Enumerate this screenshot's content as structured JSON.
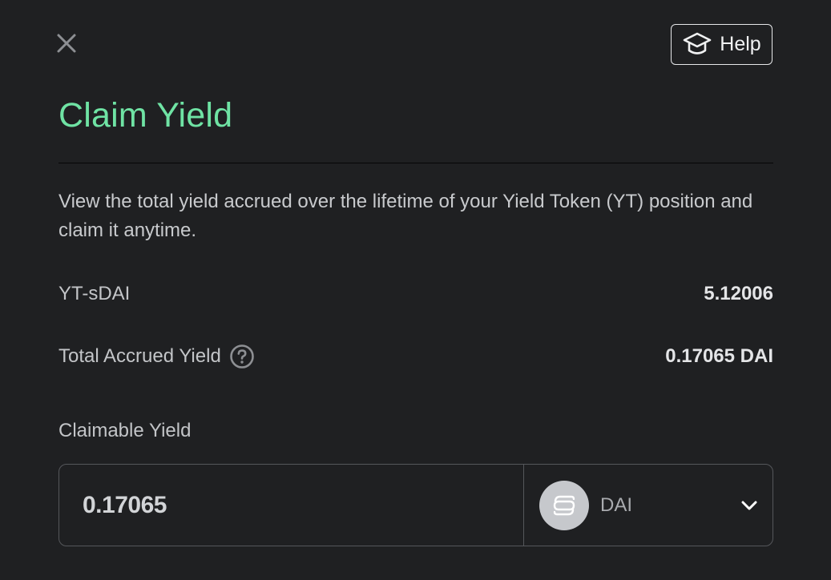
{
  "header": {
    "help_label": "Help"
  },
  "title": "Claim Yield",
  "description": "View the total yield accrued over the lifetime of your Yield Token (YT) position and claim it anytime.",
  "rows": {
    "yt": {
      "label": "YT-sDAI",
      "value": "5.12006"
    },
    "accrued": {
      "label": "Total Accrued Yield",
      "value": "0.17065 DAI"
    }
  },
  "claimable": {
    "label": "Claimable Yield",
    "amount": "0.17065",
    "token": "DAI"
  },
  "colors": {
    "background": "#1f2022",
    "accent": "#6fe3a4",
    "border": "#55575b"
  },
  "icons": {
    "close": "close-icon",
    "help": "graduation-cap-icon",
    "info": "question-circle-icon",
    "token": "sdai-logo-icon",
    "dropdown": "chevron-down-icon"
  }
}
